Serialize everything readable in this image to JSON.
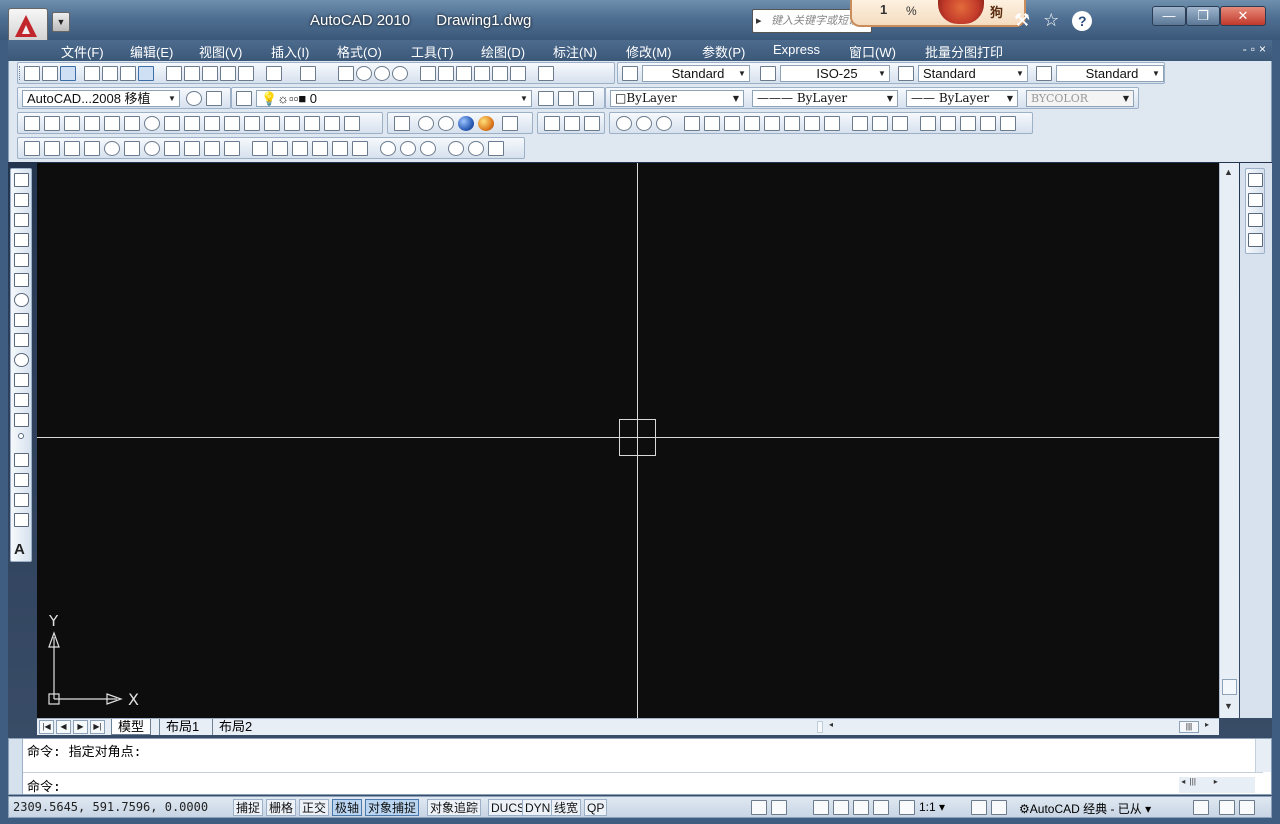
{
  "title": {
    "app": "AutoCAD 2010",
    "document": "Drawing1.dwg",
    "search_placeholder": "键入关键字或短语",
    "popup_text_1": "1",
    "popup_text_2": "%",
    "popup_text_3": "狗"
  },
  "window": {
    "minimize": "—",
    "restore": "❐",
    "close": "✕"
  },
  "menu": {
    "items": [
      "文件(F)",
      "编辑(E)",
      "视图(V)",
      "插入(I)",
      "格式(O)",
      "工具(T)",
      "绘图(D)",
      "标注(N)",
      "修改(M)",
      "参数(P)",
      "Express",
      "窗口(W)",
      "批量分图打印"
    ],
    "right_controls": "-▫×"
  },
  "styles": {
    "text_style": "Standard",
    "dim_style": "ISO-25",
    "table_style": "Standard",
    "multileader_style": "Standard"
  },
  "layers": {
    "workspace_combo": "AutoCAD...2008 移植",
    "current_layer": "0",
    "color": "ByLayer",
    "linetype": "ByLayer",
    "lineweight": "ByLayer",
    "plotstyle": "BYCOLOR"
  },
  "canvas": {
    "ucs_x": "X",
    "ucs_y": "Y"
  },
  "tabs": {
    "model": "模型",
    "layout1": "布局1",
    "layout2": "布局2"
  },
  "command": {
    "history": "命令: 指定对角点:",
    "prompt": "命令:"
  },
  "status": {
    "coordinates": "2309.5645, 591.7596, 0.0000",
    "toggles": [
      "捕捉",
      "栅格",
      "正交",
      "极轴",
      "对象捕捉",
      "对象追踪",
      "DUCS",
      "DYN",
      "线宽",
      "QP"
    ],
    "toggles_on": [
      "极轴",
      "对象捕捉"
    ],
    "annotation_scale": "1:1",
    "workspace": "AutoCAD 经典 - 已从"
  },
  "colors": {
    "canvas_bg": "#0d0d0e",
    "crosshair": "#d8d8d8",
    "title_bar": "#4f6f92",
    "logo_red": "#c0262b"
  }
}
